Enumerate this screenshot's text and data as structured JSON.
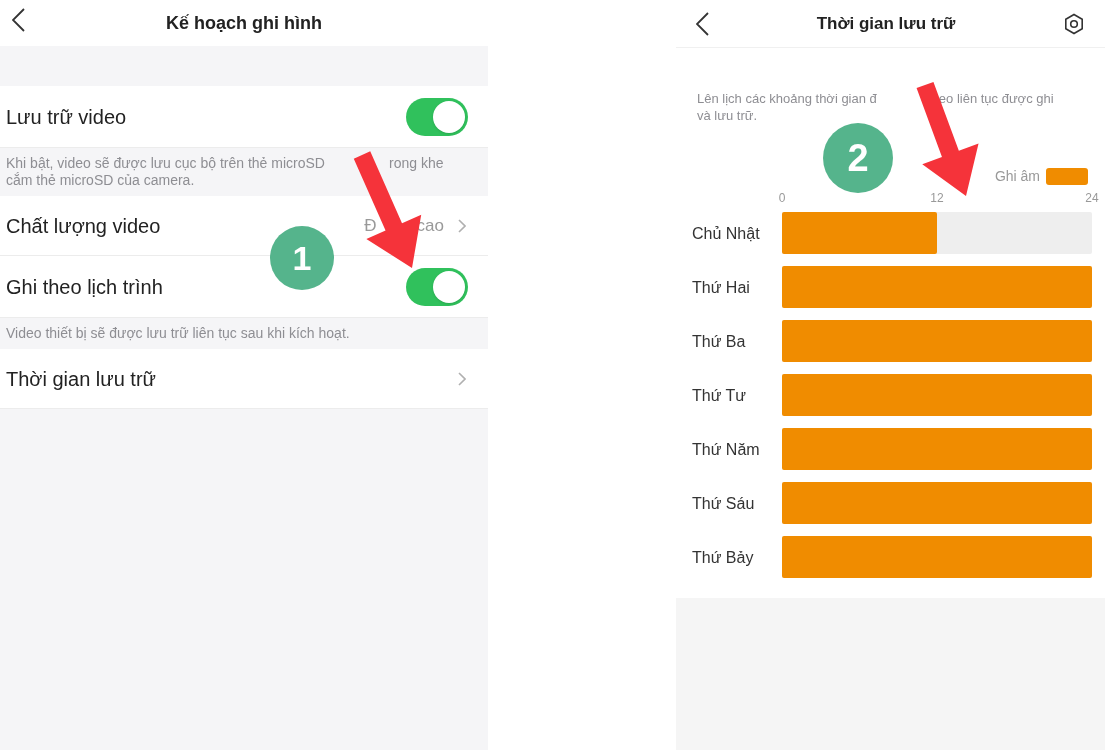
{
  "left_screen": {
    "title": "Kế hoạch ghi hình",
    "rows": [
      {
        "kind": "toggle",
        "label": "Lưu trữ video",
        "on": true
      },
      {
        "kind": "hint",
        "lines": [
          [
            "Khi bật, video sẽ được lưu cục bộ trên thẻ microSD",
            "rong khe"
          ],
          [
            "cắm thẻ microSD của camera."
          ]
        ]
      },
      {
        "kind": "link",
        "label": "Chất lượng video",
        "value_parts": [
          "Đ",
          "cao"
        ]
      },
      {
        "kind": "toggle",
        "label": "Ghi theo lịch trình",
        "on": true
      },
      {
        "kind": "hint",
        "lines": [
          [
            "Video thiết bị sẽ được lưu trữ liên tục sau khi kích hoạt."
          ]
        ]
      },
      {
        "kind": "link",
        "label": "Thời gian lưu trữ"
      }
    ]
  },
  "right_screen": {
    "title": "Thời gian lưu trữ",
    "description_lines": [
      [
        "Lên lịch các khoảng thời gian đ",
        "eo liên tục được ghi"
      ],
      [
        "và lưu trữ."
      ]
    ],
    "chart_data": {
      "type": "bar",
      "orientation": "horizontal",
      "xlim": [
        0,
        24
      ],
      "xticks": [
        0,
        12,
        24
      ],
      "categories": [
        "Chủ Nhật",
        "Thứ Hai",
        "Thứ Ba",
        "Thứ Tư",
        "Thứ Năm",
        "Thứ Sáu",
        "Thứ Bảy"
      ],
      "series": [
        {
          "name": "Ghi âm",
          "color": "#f08c00",
          "values": [
            12,
            24,
            24,
            24,
            24,
            24,
            24
          ]
        }
      ]
    }
  },
  "annotations": [
    {
      "label": "1"
    },
    {
      "label": "2"
    }
  ]
}
